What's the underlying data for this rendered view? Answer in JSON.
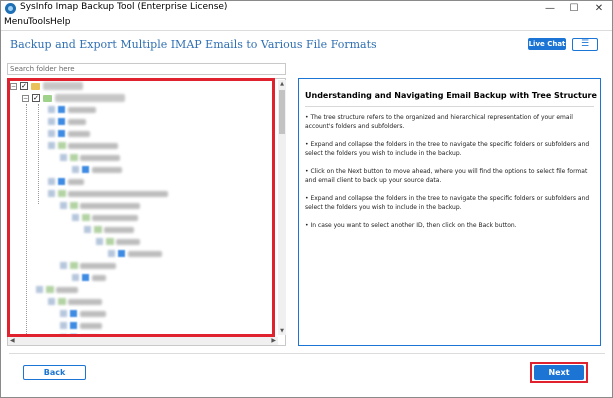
{
  "window": {
    "title": "SysInfo Imap Backup Tool (Enterprise License)",
    "minimize_glyph": "—",
    "maximize_glyph": "☐",
    "close_glyph": "✕"
  },
  "menu": {
    "items": [
      "Menu",
      "Tools",
      "Help"
    ]
  },
  "header": {
    "title": "Backup and Export Multiple IMAP Emails to Various File Formats",
    "live_chat_label": "Live Chat",
    "menu_icon_glyph": "☰"
  },
  "search": {
    "placeholder": "Search folder here"
  },
  "tree": {
    "root_checked": true,
    "expander_glyph": "−",
    "check_glyph": "✓",
    "scroll_up_glyph": "▲",
    "scroll_down_glyph": "▼",
    "scroll_left_glyph": "◀",
    "scroll_right_glyph": "▶"
  },
  "info": {
    "title": "Understanding and Navigating Email Backup with Tree Structure",
    "paragraphs": [
      "• The tree structure refers to the organized and hierarchical representation of your email account's folders and subfolders.",
      "• Expand and collapse the folders in the tree to navigate the specific folders or subfolders and select the folders you wish to include in the backup.",
      "• Click on the Next button to move ahead, where you will find the options to select file format and email client to back up your source data.",
      "• Expand and collapse the folders in the tree to navigate the specific folders or subfolders and select the folders you wish to include in the backup.",
      "• In case you want to select another ID, then click on the Back button."
    ]
  },
  "footer": {
    "back_label": "Back",
    "next_label": "Next"
  },
  "colors": {
    "accent": "#1c75d4",
    "highlight": "#e0212e",
    "header_title": "#2f6fb3"
  }
}
